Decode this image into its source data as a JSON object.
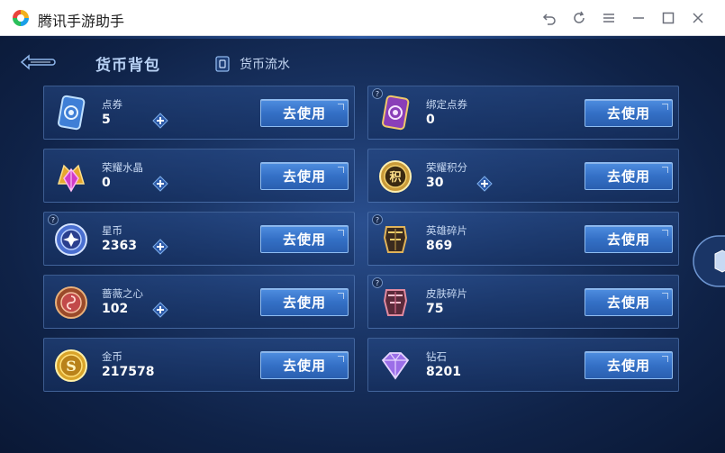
{
  "window": {
    "title": "腾讯手游助手",
    "controls": [
      "undo-icon",
      "refresh-icon",
      "menu-icon",
      "minimize-icon",
      "maximize-icon",
      "close-icon"
    ]
  },
  "header": {
    "active_tab": "货币背包",
    "flow_tab": "货币流水"
  },
  "currencies": [
    {
      "name": "点券",
      "amount": "5",
      "plus": true,
      "help": false,
      "icon": "coupon-card-icon",
      "button": "去使用"
    },
    {
      "name": "绑定点券",
      "amount": "0",
      "plus": false,
      "help": true,
      "icon": "bound-coupon-card-icon",
      "button": "去使用"
    },
    {
      "name": "荣耀水晶",
      "amount": "0",
      "plus": true,
      "help": false,
      "icon": "glory-crystal-icon",
      "button": "去使用"
    },
    {
      "name": "荣耀积分",
      "amount": "30",
      "plus": true,
      "help": false,
      "icon": "glory-points-icon",
      "button": "去使用"
    },
    {
      "name": "星币",
      "amount": "2363",
      "plus": true,
      "help": true,
      "icon": "star-coin-icon",
      "button": "去使用"
    },
    {
      "name": "英雄碎片",
      "amount": "869",
      "plus": false,
      "help": true,
      "icon": "hero-fragment-icon",
      "button": "去使用"
    },
    {
      "name": "蔷薇之心",
      "amount": "102",
      "plus": true,
      "help": false,
      "icon": "rose-heart-icon",
      "button": "去使用"
    },
    {
      "name": "皮肤碎片",
      "amount": "75",
      "plus": false,
      "help": true,
      "icon": "skin-fragment-icon",
      "button": "去使用"
    },
    {
      "name": "金币",
      "amount": "217578",
      "plus": false,
      "help": false,
      "icon": "gold-coin-icon",
      "button": "去使用"
    },
    {
      "name": "钻石",
      "amount": "8201",
      "plus": false,
      "help": false,
      "icon": "diamond-icon",
      "button": "去使用"
    }
  ],
  "colors": {
    "accent_button": "#3470c6",
    "panel_border": "#6e96d2",
    "text_light": "#c7d9f3"
  }
}
